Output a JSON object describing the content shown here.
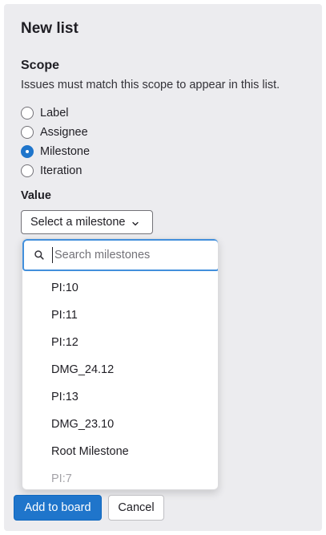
{
  "form": {
    "title": "New list",
    "scope_heading": "Scope",
    "scope_help": "Issues must match this scope to appear in this list.",
    "scope_options": [
      {
        "label": "Label",
        "checked": false
      },
      {
        "label": "Assignee",
        "checked": false
      },
      {
        "label": "Milestone",
        "checked": true
      },
      {
        "label": "Iteration",
        "checked": false
      }
    ],
    "value_label": "Value",
    "select_label": "Select a milestone"
  },
  "dropdown": {
    "search_placeholder": "Search milestones",
    "search_value": "",
    "items": [
      "PI:10",
      "PI:11",
      "PI:12",
      "DMG_24.12",
      "PI:13",
      "DMG_23.10",
      "Root Milestone",
      "PI:7"
    ]
  },
  "actions": {
    "add_label": "Add to board",
    "cancel_label": "Cancel"
  },
  "colors": {
    "accent": "#1f75cb",
    "focus_ring": "#428fdc",
    "panel_bg": "#ececef"
  },
  "icons": {
    "select_chevron": "chevron-down-icon",
    "search": "search-icon"
  }
}
